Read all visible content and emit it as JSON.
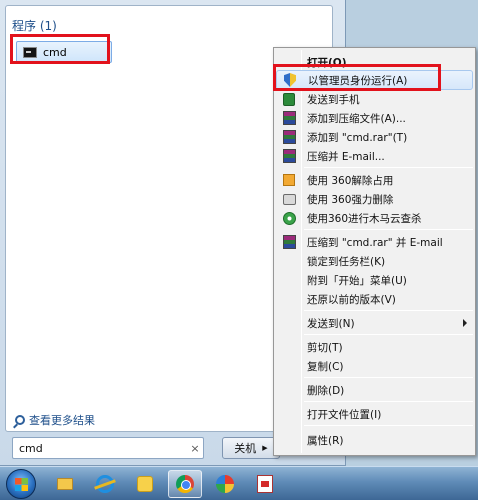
{
  "start_menu": {
    "group_header": "程序 (1)",
    "results": [
      {
        "label": "cmd",
        "icon": "command-prompt-icon"
      }
    ],
    "see_more": "查看更多结果",
    "search": {
      "value": "cmd",
      "clear_symbol": "×"
    },
    "shutdown_label": "关机",
    "shutdown_arrow": "▶"
  },
  "context_menu": {
    "items": [
      {
        "label": "打开(O)",
        "bold": true,
        "icon": ""
      },
      {
        "label": "以管理员身份运行(A)",
        "icon": "uac-shield-icon",
        "highlighted": true
      },
      {
        "label": "发送到手机",
        "icon": "phone-icon"
      },
      {
        "label": "添加到压缩文件(A)...",
        "icon": "winrar-icon"
      },
      {
        "label": "添加到 \"cmd.rar\"(T)",
        "icon": "winrar-icon"
      },
      {
        "label": "压缩并 E-mail...",
        "icon": "winrar-icon"
      },
      {
        "label": "使用 360解除占用",
        "icon": "360-unlock-icon"
      },
      {
        "label": "使用 360强力删除",
        "icon": "360-shred-icon"
      },
      {
        "label": "使用360进行木马云查杀",
        "icon": "360-scan-icon"
      },
      {
        "label": "压缩到 \"cmd.rar\" 并 E-mail",
        "icon": "winrar-icon"
      },
      {
        "label": "锁定到任务栏(K)",
        "icon": ""
      },
      {
        "label": "附到「开始」菜单(U)",
        "icon": ""
      },
      {
        "label": "还原以前的版本(V)",
        "icon": ""
      },
      {
        "label": "发送到(N)",
        "icon": "",
        "submenu": true
      },
      {
        "label": "剪切(T)",
        "icon": ""
      },
      {
        "label": "复制(C)",
        "icon": ""
      },
      {
        "label": "删除(D)",
        "icon": ""
      },
      {
        "label": "打开文件位置(I)",
        "icon": ""
      },
      {
        "label": "属性(R)",
        "icon": ""
      }
    ]
  },
  "taskbar": {
    "pinned": [
      {
        "name": "windows-explorer",
        "icon": "folder-icon"
      },
      {
        "name": "internet-explorer",
        "icon": "ie-icon"
      },
      {
        "name": "qq",
        "icon": "qq-icon"
      },
      {
        "name": "chrome",
        "icon": "chrome-icon",
        "active": true
      },
      {
        "name": "paint",
        "icon": "paint-icon"
      },
      {
        "name": "pdf-reader",
        "icon": "pdf-icon"
      }
    ]
  },
  "colors": {
    "highlight_box": "#e2121c",
    "link_blue": "#1e4f8a",
    "menu_hover": "#d6e7fa"
  }
}
